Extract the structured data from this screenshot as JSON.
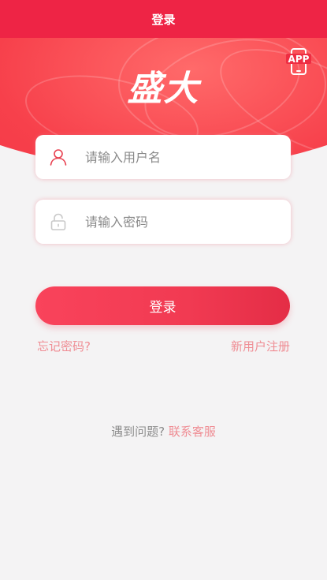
{
  "header": {
    "title": "登录"
  },
  "brand": {
    "logo_text": "盛大",
    "app_badge": "APP"
  },
  "form": {
    "username": {
      "placeholder": "请输入用户名",
      "value": "",
      "icon": "user-icon"
    },
    "password": {
      "placeholder": "请输入密码",
      "value": "",
      "icon": "lock-icon"
    },
    "submit_label": "登录"
  },
  "links": {
    "forgot_password": "忘记密码?",
    "register": "新用户注册"
  },
  "help": {
    "question": "遇到问题?",
    "contact": "联系客服"
  },
  "colors": {
    "primary": "#ee2445",
    "link": "#ef8d94",
    "background": "#f4f3f4"
  }
}
